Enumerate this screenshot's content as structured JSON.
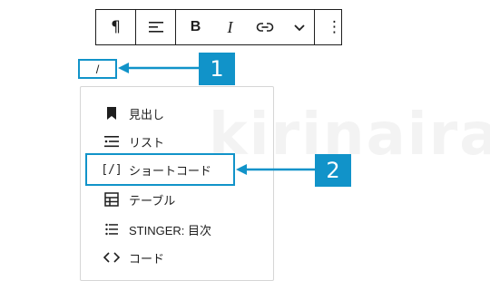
{
  "toolbar": {
    "paragraph_icon": "¶",
    "align_icon": "align-left-icon",
    "bold_label": "B",
    "italic_label": "I",
    "link_icon": "link-icon",
    "more_icon": "chevron-down-icon",
    "options_icon": "⋮"
  },
  "editor": {
    "slash_text": "/"
  },
  "callouts": {
    "one": "1",
    "two": "2"
  },
  "menu": {
    "items": [
      {
        "icon": "bookmark-icon",
        "label": "見出し"
      },
      {
        "icon": "list-icon",
        "label": "リスト"
      },
      {
        "icon_text": "[/]",
        "label": "ショートコード"
      },
      {
        "icon": "table-icon",
        "label": "テーブル"
      },
      {
        "icon": "list-icon",
        "label": "STINGER: 目次"
      },
      {
        "icon_text": "<>",
        "label": "コード"
      }
    ]
  },
  "watermark": "kirinaira",
  "colors": {
    "accent": "#1193c9",
    "text": "#1e1e1e"
  }
}
